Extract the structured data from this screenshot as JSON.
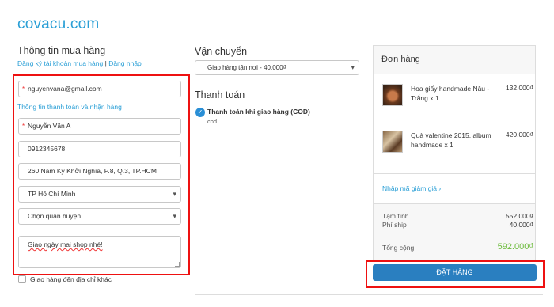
{
  "header": {
    "logo": "covacu.com"
  },
  "customer": {
    "title": "Thông tin mua hàng",
    "register_link": "Đăng ký tài khoản mua hàng",
    "separator": "|",
    "login_link": "Đăng nhập",
    "email_value": "nguyenvana@gmail.com",
    "billing_heading": "Thông tin thanh toán và nhận hàng",
    "name_value": "Nguyễn Văn A",
    "phone_value": "0912345678",
    "address_value": "260 Nam Kỳ Khởi Nghĩa, P.8, Q.3, TP.HCM",
    "city_selected": "TP Hồ Chí Minh",
    "district_selected": "Chọn quận huyện",
    "note_value": "Giao ngày mai shop nhé!",
    "ship_other_label": "Giao hàng đến địa chỉ khác",
    "required_mark": "*"
  },
  "shipping": {
    "title": "Vận chuyển",
    "selected_option": "Giao hàng tận nơi - 40.000₫"
  },
  "payment": {
    "title": "Thanh toán",
    "method_label": "Thanh toán khi giao hàng (COD)",
    "method_sub": "cod",
    "check_glyph": "✓"
  },
  "order": {
    "title": "Đơn hàng",
    "items": [
      {
        "name": "Hoa giấy handmade Nâu - Trắng x 1",
        "price": "132.000₫"
      },
      {
        "name": "Quà valentine 2015, album handmade x 1",
        "price": "420.000₫"
      }
    ],
    "discount_link": "Nhập mã giảm giá",
    "discount_chevron": "›",
    "subtotal_label": "Tạm tính",
    "subtotal_value": "552.000₫",
    "shipping_label": "Phí ship",
    "shipping_value": "40.000₫",
    "total_label": "Tổng cộng",
    "total_value": "592.000₫",
    "submit_label": "ĐẶT HÀNG"
  },
  "colors": {
    "accent": "#2a9fd6",
    "button": "#2a7fc0",
    "total": "#6bbb3a",
    "highlight": "#ee1111"
  }
}
